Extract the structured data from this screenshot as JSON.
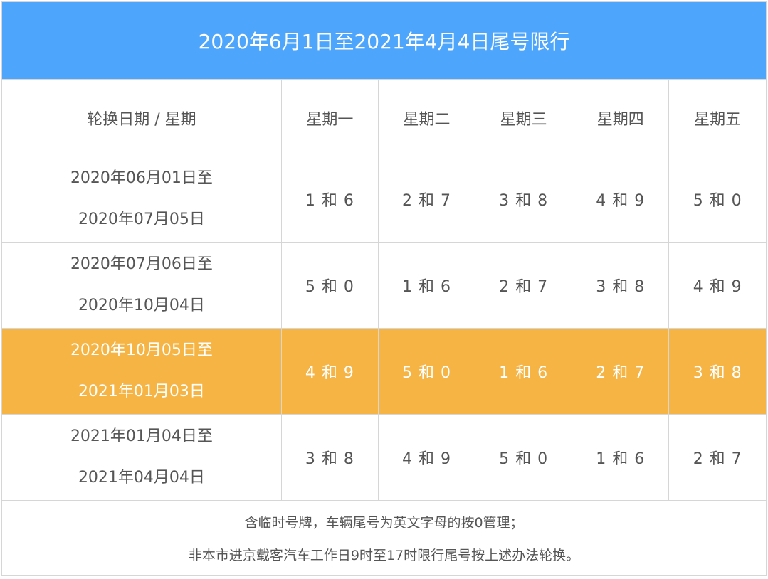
{
  "title": "2020年6月1日至2021年4月4日尾号限行",
  "header": {
    "first_col": "轮换日期 / 星期",
    "days": [
      "星期一",
      "星期二",
      "星期三",
      "星期四",
      "星期五"
    ]
  },
  "rows": [
    {
      "start": "2020年06月01日至",
      "end": "2020年07月05日",
      "values": [
        "1 和 6",
        "2 和 7",
        "3 和 8",
        "4 和 9",
        "5 和 0"
      ],
      "highlight": false
    },
    {
      "start": "2020年07月06日至",
      "end": "2020年10月04日",
      "values": [
        "5 和 0",
        "1 和 6",
        "2 和 7",
        "3 和 8",
        "4 和 9"
      ],
      "highlight": false
    },
    {
      "start": "2020年10月05日至",
      "end": "2021年01月03日",
      "values": [
        "4 和 9",
        "5 和 0",
        "1 和 6",
        "2 和 7",
        "3 和 8"
      ],
      "highlight": true
    },
    {
      "start": "2021年01月04日至",
      "end": "2021年04月04日",
      "values": [
        "3 和 8",
        "4 和 9",
        "5 和 0",
        "1 和 6",
        "2 和 7"
      ],
      "highlight": false
    }
  ],
  "footer": {
    "line1": "含临时号牌，车辆尾号为英文字母的按0管理；",
    "line2": "非本市进京载客汽车工作日9时至17时限行尾号按上述办法轮换。"
  },
  "colors": {
    "title_bg": "#4ea6fc",
    "highlight_bg": "#f5b443",
    "text": "#555555",
    "border": "#d6d6d6"
  }
}
